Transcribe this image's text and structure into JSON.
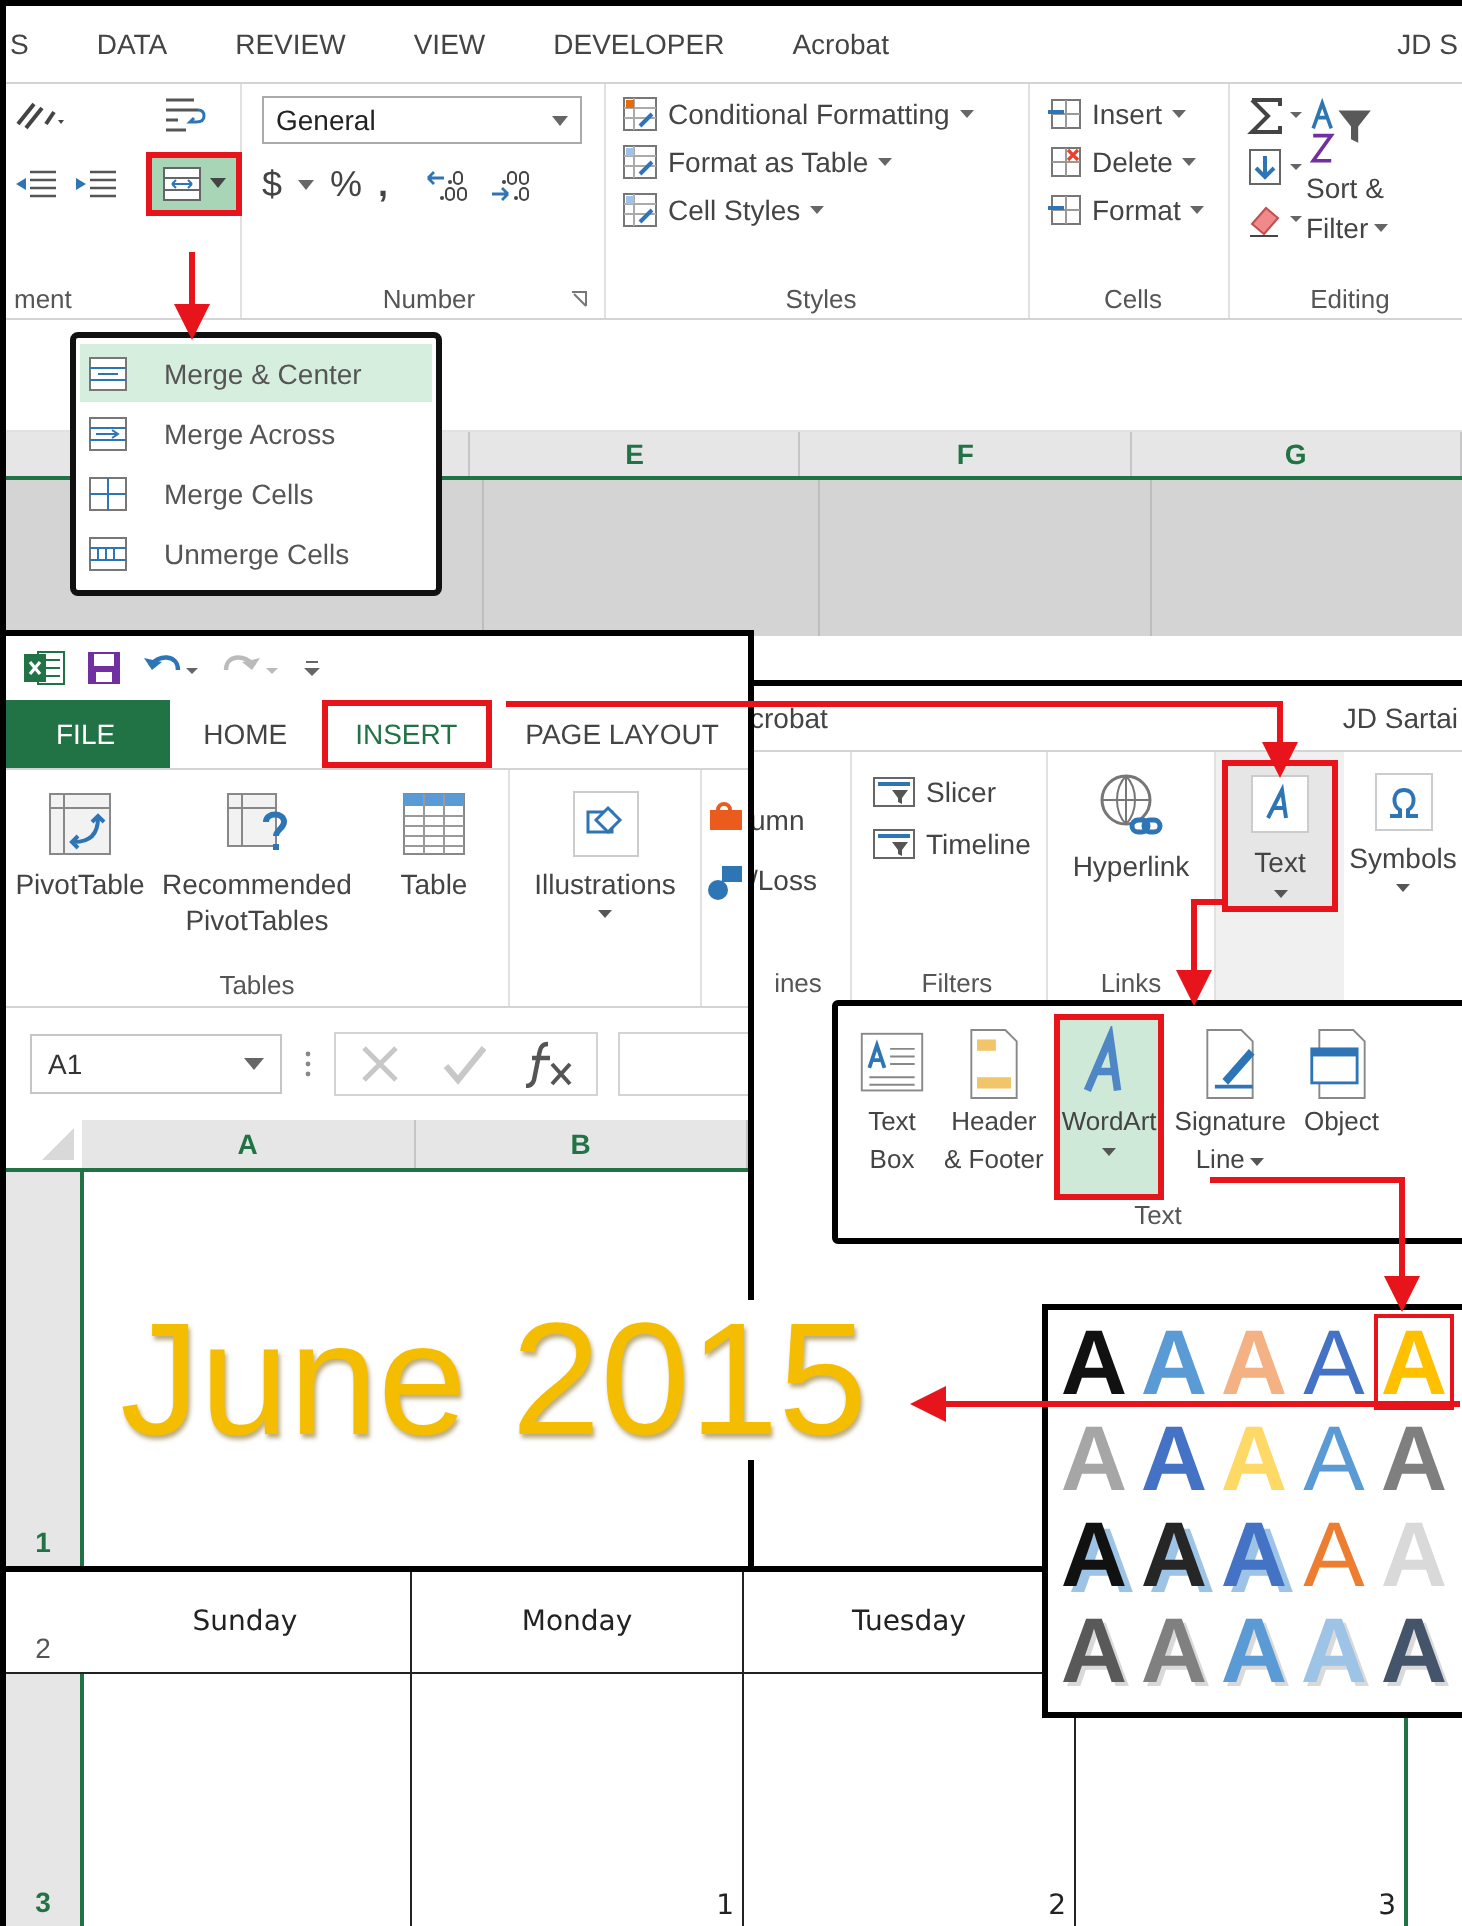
{
  "home_window": {
    "tabs": [
      {
        "label": "S",
        "selected": false
      },
      {
        "label": "DATA",
        "selected": false
      },
      {
        "label": "REVIEW",
        "selected": false
      },
      {
        "label": "VIEW",
        "selected": false
      },
      {
        "label": "DEVELOPER",
        "selected": false
      },
      {
        "label": "Acrobat",
        "selected": false
      },
      {
        "label": "JD S",
        "selected": false
      }
    ],
    "alignment": {
      "label": "ment",
      "merge_selected": true
    },
    "number": {
      "format": "General",
      "symbols": [
        "$",
        "%",
        ","
      ],
      "label": "Number"
    },
    "styles": {
      "items": [
        "Conditional Formatting",
        "Format as Table",
        "Cell Styles"
      ],
      "label": "Styles"
    },
    "cells": {
      "items": [
        "Insert",
        "Delete",
        "Format"
      ],
      "label": "Cells"
    },
    "editing": {
      "sort": "Sort &",
      "filter": "Filter",
      "label": "Editing"
    },
    "columns": [
      "E",
      "F",
      "G"
    ]
  },
  "merge_menu": {
    "items": [
      {
        "label": "Merge & Center",
        "selected": true
      },
      {
        "label": "Merge Across",
        "selected": false
      },
      {
        "label": "Merge Cells",
        "selected": false
      },
      {
        "label": "Unmerge Cells",
        "selected": false
      }
    ]
  },
  "insert_window": {
    "tabs": [
      {
        "label": "FILE",
        "kind": "file",
        "selected": false
      },
      {
        "label": "HOME",
        "kind": "tab",
        "selected": false
      },
      {
        "label": "INSERT",
        "kind": "tab",
        "selected": true
      },
      {
        "label": "PAGE LAYOUT",
        "kind": "tab",
        "selected": false
      }
    ],
    "tables": {
      "buttons": [
        "PivotTable",
        "Recommended PivotTables",
        "Table"
      ],
      "label": "Tables"
    },
    "illustrations": "Illustrations",
    "name_box": "A1",
    "columns": [
      "A",
      "B"
    ],
    "title": "June 2015",
    "row_number": "1"
  },
  "insert_ribbon_right": {
    "tabs": [
      "crobat",
      "JD Sartai"
    ],
    "sparklines": {
      "items": [
        "umn",
        "/Loss"
      ],
      "label": "ines"
    },
    "filters": {
      "items": [
        "Slicer",
        "Timeline"
      ],
      "label": "Filters"
    },
    "links": {
      "button": "Hyperlink",
      "label": "Links"
    },
    "text_button": {
      "label": "Text",
      "selected": true
    },
    "symbols": "Symbols"
  },
  "text_group": {
    "buttons": [
      {
        "lines": [
          "Text",
          "Box"
        ],
        "selected": false,
        "dropdown": false
      },
      {
        "lines": [
          "Header",
          "& Footer"
        ],
        "selected": false,
        "dropdown": false
      },
      {
        "lines": [
          "WordArt"
        ],
        "selected": true,
        "dropdown": true
      },
      {
        "lines": [
          "Signature",
          "Line"
        ],
        "selected": false,
        "dropdown": true
      },
      {
        "lines": [
          "Object"
        ],
        "selected": false,
        "dropdown": false
      }
    ],
    "label": "Text"
  },
  "wordart_gallery": {
    "styles": [
      {
        "letter": "A",
        "kind": "fill",
        "color": "#111111",
        "selected": false
      },
      {
        "letter": "A",
        "kind": "fill",
        "color": "#5b9bd5",
        "selected": false
      },
      {
        "letter": "A",
        "kind": "fill",
        "color": "#f4b183",
        "selected": false
      },
      {
        "letter": "A",
        "kind": "outline",
        "color": "#4472c4",
        "selected": false
      },
      {
        "letter": "A",
        "kind": "fill",
        "color": "#ffc000",
        "selected": true
      },
      {
        "letter": "A",
        "kind": "fill",
        "color": "#a6a6a6",
        "selected": false
      },
      {
        "letter": "A",
        "kind": "fill",
        "color": "#4472c4",
        "selected": false
      },
      {
        "letter": "A",
        "kind": "fill",
        "color": "#ffd966",
        "selected": false
      },
      {
        "letter": "A",
        "kind": "outline",
        "color": "#5b9bd5",
        "selected": false
      },
      {
        "letter": "A",
        "kind": "fill",
        "color": "#7f7f7f",
        "selected": false
      },
      {
        "letter": "A",
        "kind": "shadow",
        "color": "#111111",
        "selected": false
      },
      {
        "letter": "A",
        "kind": "shadow",
        "color": "#262626",
        "selected": false
      },
      {
        "letter": "A",
        "kind": "shadow",
        "color": "#4472c4",
        "selected": false
      },
      {
        "letter": "A",
        "kind": "outline",
        "color": "#ed7d31",
        "selected": false
      },
      {
        "letter": "A",
        "kind": "fill",
        "color": "#d9d9d9",
        "selected": false
      },
      {
        "letter": "A",
        "kind": "pattern",
        "color": "#595959",
        "selected": false
      },
      {
        "letter": "A",
        "kind": "pattern",
        "color": "#808080",
        "selected": false
      },
      {
        "letter": "A",
        "kind": "pattern",
        "color": "#5b9bd5",
        "selected": false
      },
      {
        "letter": "A",
        "kind": "pattern",
        "color": "#9dc3e6",
        "selected": false
      },
      {
        "letter": "A",
        "kind": "pattern",
        "color": "#44546a",
        "selected": false
      }
    ]
  },
  "calendar": {
    "days": [
      "Sunday",
      "Monday",
      "Tuesday"
    ],
    "rows": [
      "2",
      "3"
    ],
    "dates": [
      "1",
      "2",
      "3"
    ]
  }
}
